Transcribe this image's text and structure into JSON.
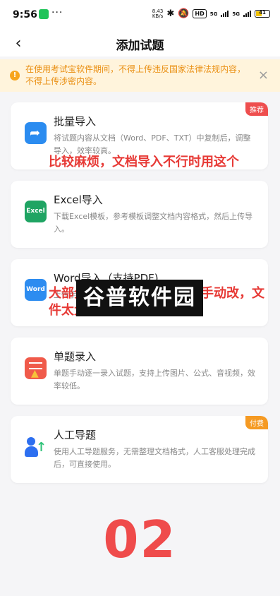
{
  "status_bar": {
    "time": "9:56",
    "more": "···",
    "speed": "8.43\nKB/s",
    "hd": "HD",
    "network1": "5G",
    "network2": "5G",
    "battery": "41"
  },
  "nav": {
    "back": "‹",
    "title": "添加试题"
  },
  "notice": {
    "text": "在使用考试宝软件期间，不得上传违反国家法律法规内容，不得上传涉密内容。",
    "close": "×",
    "icon_text": "!"
  },
  "cards": [
    {
      "title": "批量导入",
      "desc": "将试题内容从文档（Word、PDF、TXT）中复制后，调整导入，效率较高。",
      "badge": "推荐",
      "icon": "share-arrow-icon",
      "badge_color": "#ee4e4e"
    },
    {
      "title": "Excel导入",
      "desc": "下载Excel模板，参考模板调整文档内容格式，然后上传导入。",
      "icon_text": "Excel",
      "icon": "excel-icon"
    },
    {
      "title": "Word导入（支持PDF)",
      "desc": "上传手动调整文档内容格式，然后上传",
      "icon_text": "Word",
      "icon": "word-icon"
    },
    {
      "title": "单题录入",
      "desc": "单题手动逐一录入试题，支持上传图片、公式、音视频，效率较低。",
      "icon": "single-entry-icon"
    },
    {
      "title": "人工导题",
      "desc": "使用人工导题服务，无需整理文档格式，人工客服处理完成后，可直接使用。",
      "badge": "付费",
      "icon": "manual-import-icon",
      "badge_color": "#f59a23"
    }
  ],
  "annotations": {
    "note1": "比较麻烦，文档导入不行时用这个",
    "note2": "大部分格式会识别出错，要手动改，文件太大的无法上传"
  },
  "watermark": "谷普软件园",
  "step_number": "02",
  "colors": {
    "accent_red": "#e73a36",
    "notice_bg": "#fff4dc",
    "notice_text": "#ea8f12"
  }
}
